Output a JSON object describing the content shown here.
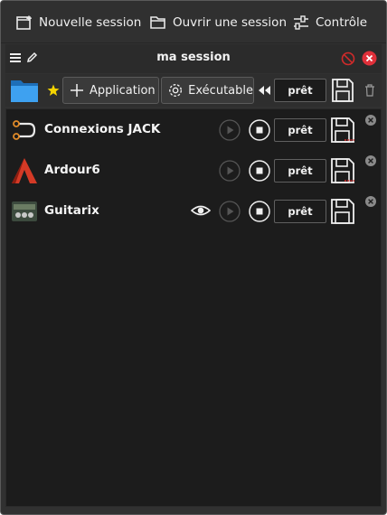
{
  "menubar": {
    "new_session": "Nouvelle session",
    "open_session": "Ouvrir une session",
    "control": "Contrôle"
  },
  "session": {
    "title": "ma session",
    "application_label": "Application",
    "executable_label": "Exécutable",
    "status": "prêt"
  },
  "clients": [
    {
      "name": "Connexions JACK",
      "status": "prêt",
      "icon": "jack-connections-icon"
    },
    {
      "name": "Ardour6",
      "status": "prêt",
      "icon": "ardour-icon"
    },
    {
      "name": "Guitarix",
      "status": "prêt",
      "icon": "guitarix-icon"
    }
  ],
  "colors": {
    "background": "#313131",
    "list_background": "#1c1c1c",
    "close_red": "#e0303a",
    "abort_red": "#d02a2a",
    "folder_blue": "#2f8fe0",
    "star_yellow": "#f5d400"
  }
}
